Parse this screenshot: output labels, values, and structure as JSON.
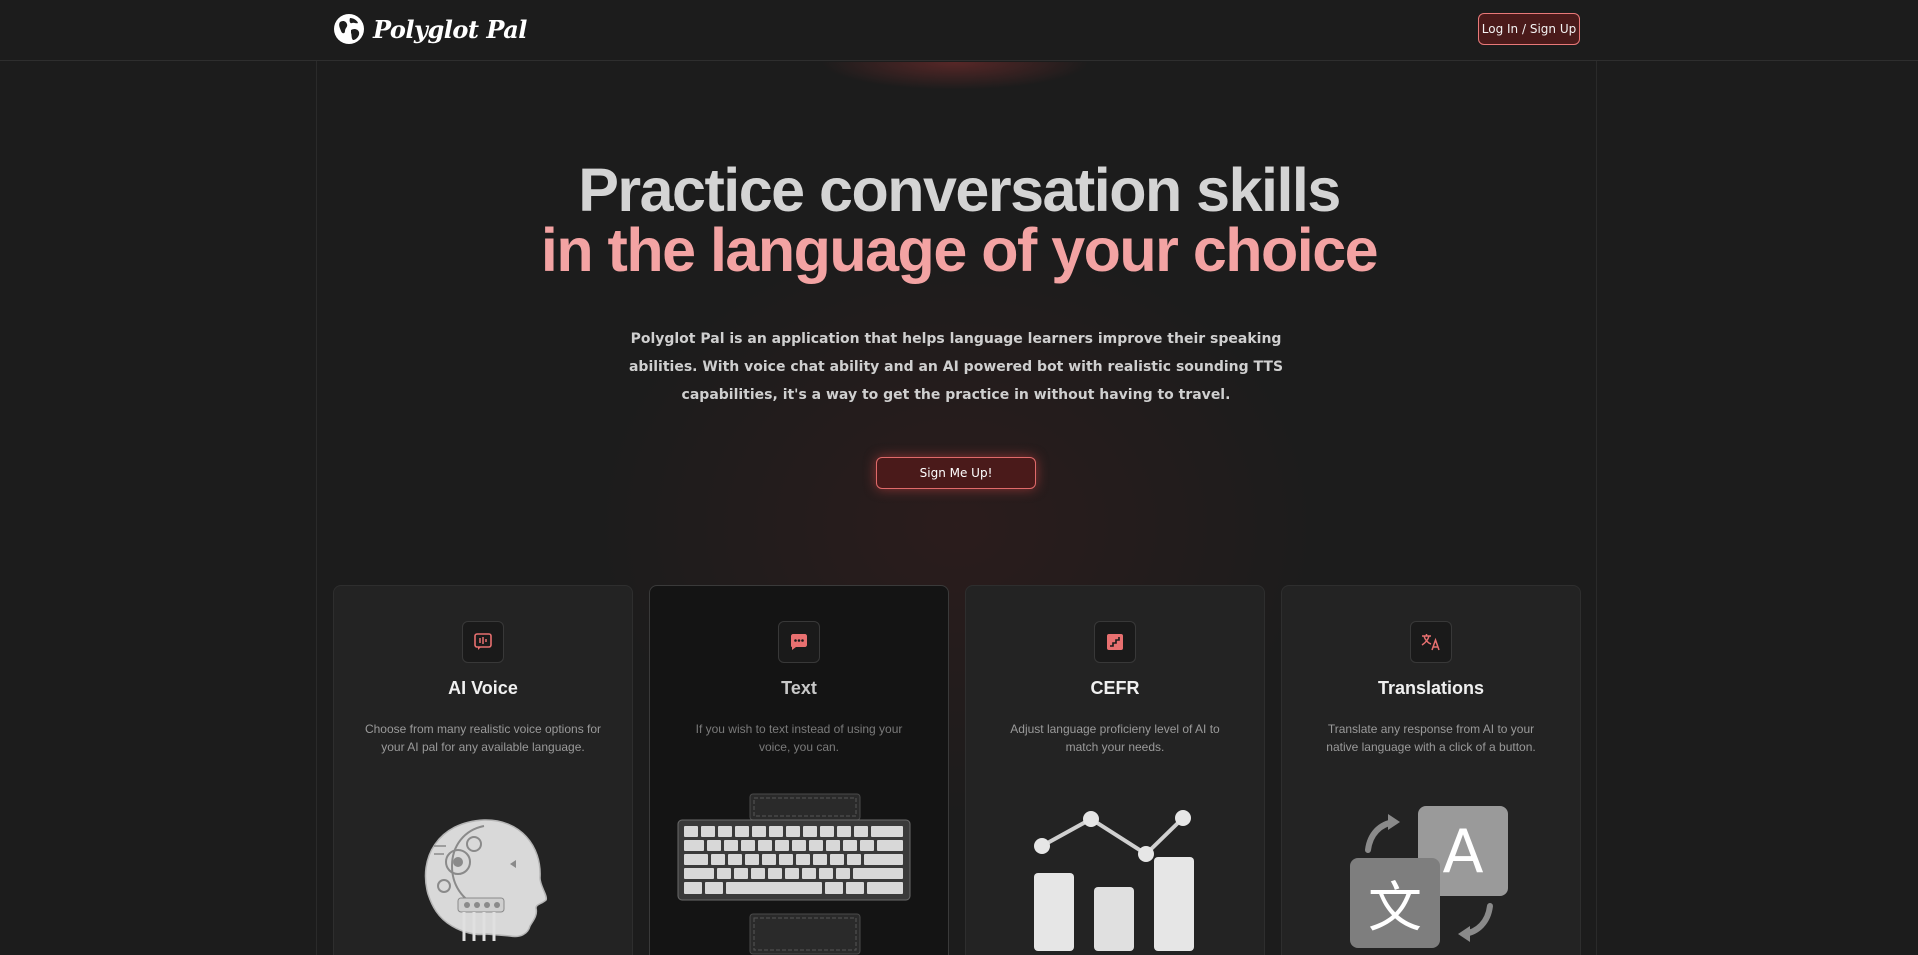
{
  "brand": {
    "name": "Polyglot Pal",
    "accent": "#f3a3a3",
    "button_border": "#e87878"
  },
  "nav": {
    "login_label": "Log In / Sign Up"
  },
  "hero": {
    "title_line1": "Practice conversation skills",
    "title_line2": "in the language of your choice",
    "description": "Polyglot Pal is an application that helps language learners improve their speaking abilities. With voice chat ability and an AI powered bot with realistic sounding TTS capabilities, it's a way to get the practice in without having to travel.",
    "cta_label": "Sign Me Up!"
  },
  "features": [
    {
      "icon": "voice-message-icon",
      "title": "AI Voice",
      "description": "Choose from many realistic voice options for your AI pal for any available language.",
      "illustration": "robot-head-illustration"
    },
    {
      "icon": "chat-bubble-icon",
      "title": "Text",
      "description": "If you wish to text instead of using your voice, you can.",
      "illustration": "keyboard-illustration"
    },
    {
      "icon": "stairs-icon",
      "title": "CEFR",
      "description": "Adjust language proficieny level of AI to match your needs.",
      "illustration": "chart-illustration"
    },
    {
      "icon": "translate-icon",
      "title": "Translations",
      "description": "Translate any response from AI to your native language with a click of a button.",
      "illustration": "translation-illustration"
    }
  ]
}
